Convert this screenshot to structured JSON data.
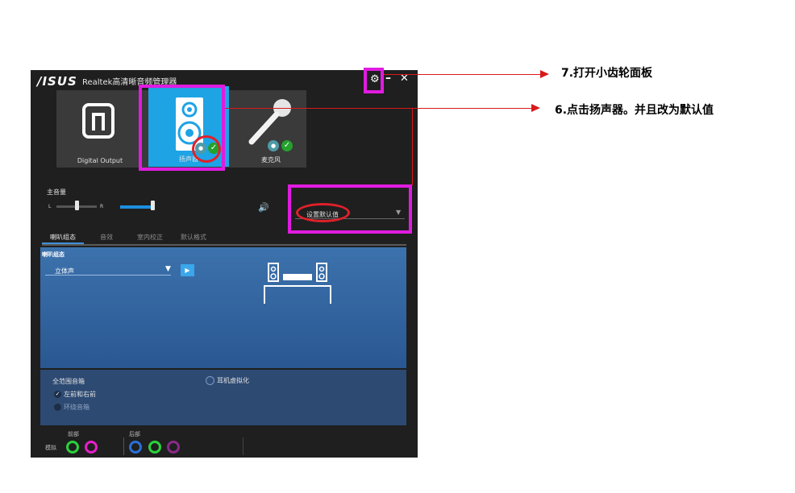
{
  "window": {
    "logo": "/ISUS",
    "title": "Realtek高清晰音频管理器",
    "controls": {
      "settings_icon": "gear-icon",
      "minimize": "–",
      "close": "✕"
    }
  },
  "devices": [
    {
      "label": "Digital Output",
      "icon": "digital-output-icon",
      "selected": false
    },
    {
      "label": "扬声器",
      "icon": "speaker-icon",
      "selected": true
    },
    {
      "label": "麦克风",
      "icon": "microphone-icon",
      "selected": false
    }
  ],
  "volume": {
    "label": "主音量",
    "left": "L",
    "right": "R",
    "balance": 0.5,
    "level": 1.0
  },
  "default_device": {
    "value": "设置默认值"
  },
  "tabs": [
    {
      "label": "喇叭组态",
      "active": true
    },
    {
      "label": "音效",
      "active": false
    },
    {
      "label": "室内校正",
      "active": false
    },
    {
      "label": "默认格式",
      "active": false
    }
  ],
  "config": {
    "title": "喇叭组态",
    "selected": "立体声"
  },
  "fullrange": {
    "title": "全范围音箱",
    "front": "左前和右前",
    "surround": "环绕音箱",
    "virtualization": "耳机虚拟化"
  },
  "ports": {
    "front_label": "前部",
    "rear_label": "后部",
    "analog_label": "模拟"
  },
  "colors": {
    "accent": "#1ea3e5",
    "highlight": "#e01be0",
    "annotation": "#d81a1a",
    "jack_green": "#2bd23b",
    "jack_pink": "#e61fc8",
    "jack_blue": "#2b6fd8",
    "jack_purple": "#8a2a8a"
  },
  "annotations": [
    {
      "text": "7.打开小齿轮面板"
    },
    {
      "text": "6.点击扬声器。并且改为默认值"
    }
  ]
}
